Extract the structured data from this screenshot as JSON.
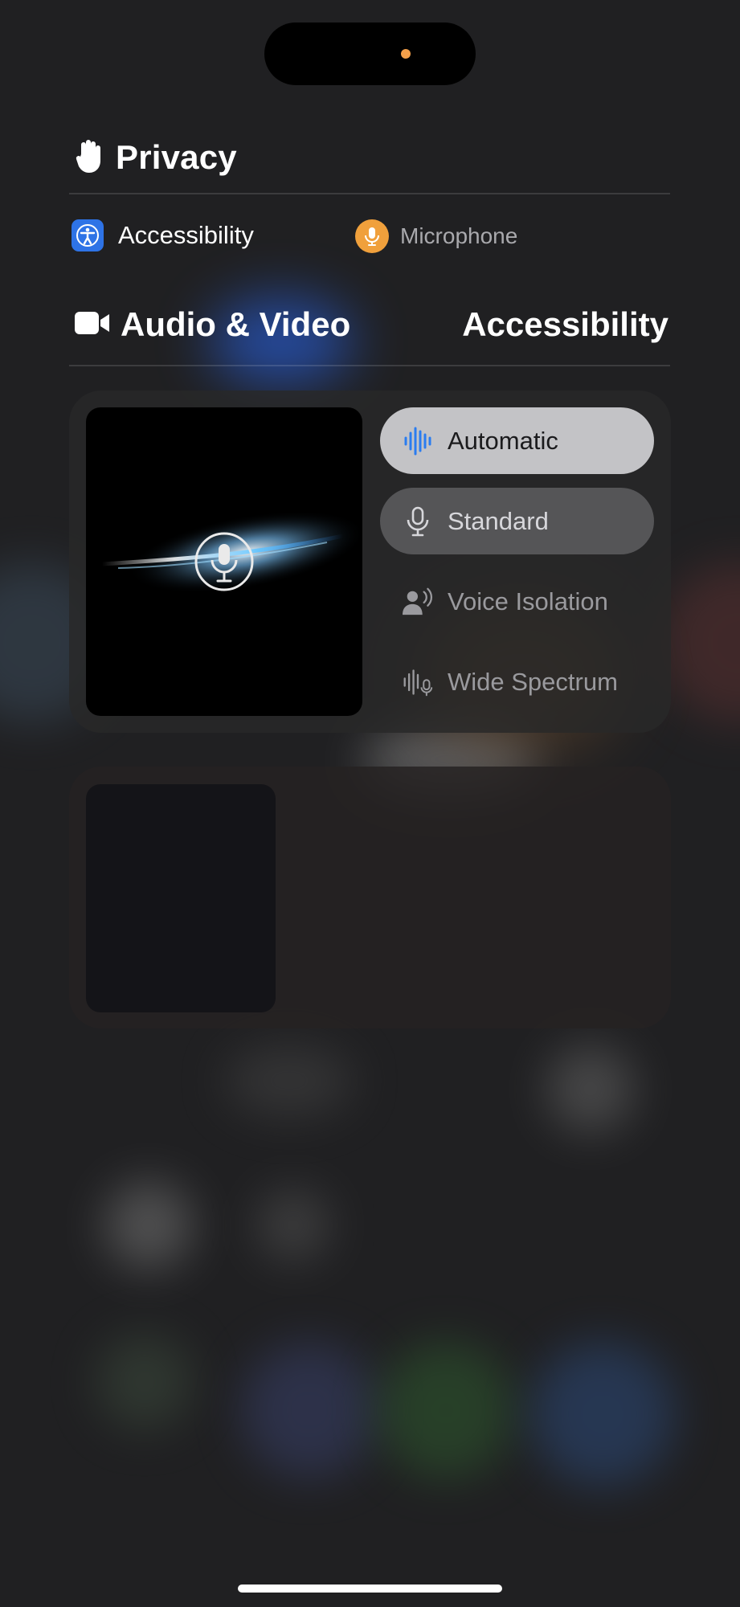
{
  "privacy": {
    "title": "Privacy",
    "icon": "hand-icon"
  },
  "indicators": {
    "accessibility_label": "Accessibility",
    "accessibility_icon": "accessibility-icon",
    "microphone_label": "Microphone",
    "microphone_icon": "microphone-icon",
    "microphone_color": "#f0a03c"
  },
  "tabs": {
    "audio_video_label": "Audio & Video",
    "audio_video_icon": "video-camera-icon",
    "accessibility_label": "Accessibility"
  },
  "mic_mode": {
    "preview_icon": "microphone-icon",
    "options": [
      {
        "label": "Automatic",
        "icon": "waveform-icon",
        "state": "selected"
      },
      {
        "label": "Standard",
        "icon": "microphone-icon",
        "state": "available"
      },
      {
        "label": "Voice Isolation",
        "icon": "voice-isolation-icon",
        "state": "dim"
      },
      {
        "label": "Wide Spectrum",
        "icon": "wide-spectrum-icon",
        "state": "dim"
      }
    ]
  },
  "colors": {
    "accent_blue": "#2e73e6",
    "island_indicator": "#f5a04a"
  }
}
